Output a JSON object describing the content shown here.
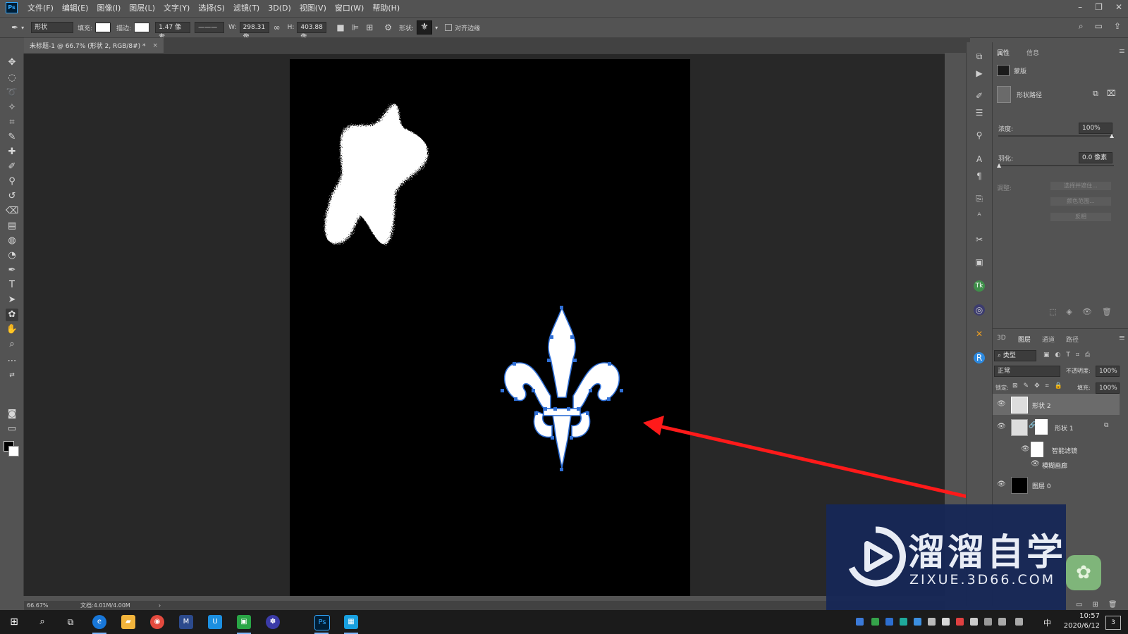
{
  "app": {
    "logo": "Ps"
  },
  "menu": [
    "文件(F)",
    "编辑(E)",
    "图像(I)",
    "图层(L)",
    "文字(Y)",
    "选择(S)",
    "滤镜(T)",
    "3D(D)",
    "视图(V)",
    "窗口(W)",
    "帮助(H)"
  ],
  "options": {
    "mode": "形状",
    "fill_label": "填充:",
    "stroke_label": "描边:",
    "stroke_width": "1.47 像素",
    "w_label": "W:",
    "w_value": "298.31 像",
    "h_label": "H:",
    "h_value": "403.88 像",
    "shape_label": "形状:",
    "align_edges": "对齐边缘"
  },
  "document": {
    "tab_title": "未标题-1 @ 66.7% (形状 2, RGB/8#) *",
    "zoom": "66.67%",
    "doc_size": "文档:4.01M/4.00M"
  },
  "properties": {
    "tabs": [
      "属性",
      "信息"
    ],
    "type": "蒙版",
    "shape_path": "形状路径",
    "density_label": "浓度:",
    "density_value": "100%",
    "feather_label": "羽化:",
    "feather_value": "0.0 像素",
    "refine_label": "调整:",
    "buttons": [
      "选择并遮住...",
      "颜色范围...",
      "反相"
    ]
  },
  "layers": {
    "tabs": [
      "3D",
      "图层",
      "通道",
      "路径"
    ],
    "filter_kind": "类型",
    "blend_mode": "正常",
    "opacity_label": "不透明度:",
    "opacity_value": "100%",
    "lock_label": "锁定:",
    "fill_label": "填充:",
    "fill_value": "100%",
    "items": [
      {
        "name": "形状 2"
      },
      {
        "name": "形状 1"
      },
      {
        "name": "智能滤镜"
      },
      {
        "name": "模糊画廊"
      },
      {
        "name": "图层 0"
      }
    ]
  },
  "watermark": {
    "title": "溜溜自学",
    "url": "ZIXUE.3D66.COM"
  },
  "taskbar": {
    "time": "10:57",
    "date": "2020/6/12",
    "ime": "中",
    "notif": "3"
  },
  "colors": {
    "accent": "#31a8ff",
    "arrow": "#ff1a1a",
    "anchor": "#2f6fd6",
    "watermark_bg": "#162756"
  }
}
